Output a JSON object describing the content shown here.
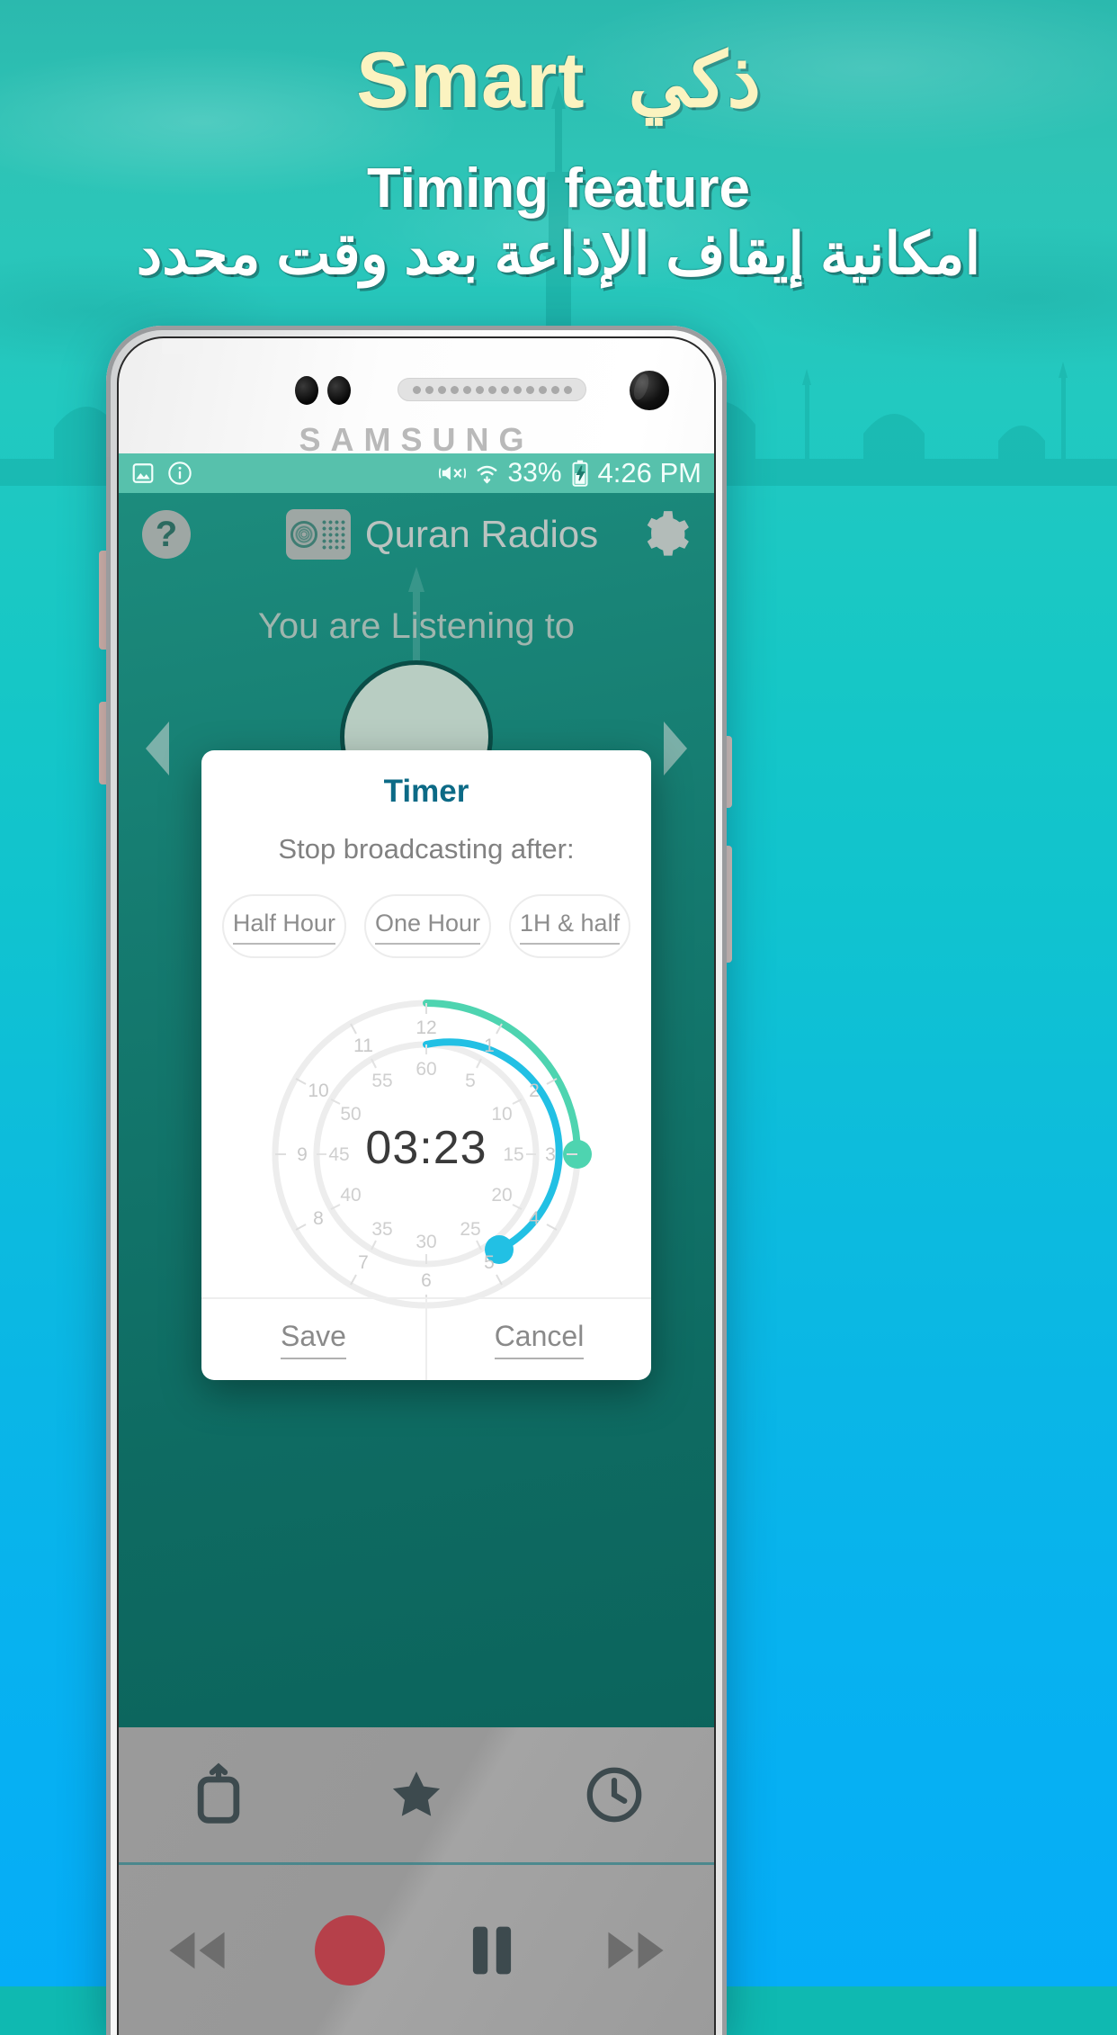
{
  "promo": {
    "headline_en": "Smart",
    "headline_ar": "ذكي",
    "subhead_en": "Timing feature",
    "subhead_ar": "امكانية إيقاف الإذاعة بعد وقت محدد"
  },
  "phone": {
    "brand": "SAMSUNG"
  },
  "statusbar": {
    "image_icon": "image-icon",
    "info_icon": "info-icon",
    "mute_icon": "volume-mute-icon",
    "wifi_icon": "wifi-icon",
    "battery_percent": "33%",
    "battery_icon": "battery-charging-icon",
    "clock": "4:26 PM"
  },
  "appbar": {
    "help_icon": "help-icon",
    "app_icon": "radio-icon",
    "title": "Quran Radios",
    "settings_icon": "gear-icon"
  },
  "screen": {
    "listening_label": "You are Listening to",
    "prev_chevron": "chevron-left-icon",
    "next_chevron": "chevron-right-icon"
  },
  "tabs": [
    {
      "name": "tab-radio",
      "icon": "radio-tower-icon"
    },
    {
      "name": "tab-favorites",
      "icon": "star-icon"
    },
    {
      "name": "tab-timer",
      "icon": "clock-icon"
    }
  ],
  "controls": [
    {
      "name": "rewind-button",
      "icon": "rewind-icon"
    },
    {
      "name": "record-button",
      "icon": "record-icon"
    },
    {
      "name": "pause-button",
      "icon": "pause-icon"
    },
    {
      "name": "forward-button",
      "icon": "fast-forward-icon"
    }
  ],
  "dialog": {
    "title": "Timer",
    "subtitle": "Stop broadcasting after:",
    "presets": [
      {
        "label": "Half Hour"
      },
      {
        "label": "One Hour"
      },
      {
        "label": "1H & half"
      }
    ],
    "time_value": "03:23",
    "save_label": "Save",
    "cancel_label": "Cancel"
  },
  "chart_data": {
    "type": "radial-dial",
    "title": "Timer dial",
    "value_text": "03:23",
    "rings": [
      {
        "name": "hours",
        "color": "#4ed4b0",
        "track_color": "#ececec",
        "ticks": [
          12,
          1,
          2,
          3,
          4,
          5,
          6,
          7,
          8,
          9,
          10,
          11
        ],
        "max": 12,
        "value": 3,
        "sweep_degrees": 90
      },
      {
        "name": "minutes",
        "color": "#22c0e4",
        "track_color": "#ececec",
        "ticks": [
          60,
          5,
          10,
          15,
          20,
          25,
          30,
          35,
          40,
          45,
          50,
          55
        ],
        "max": 60,
        "value": 23,
        "sweep_degrees": 138
      }
    ]
  },
  "colors": {
    "accent_green": "#4ed4b0",
    "accent_cyan": "#22c0e4",
    "dialog_title": "#0c6a86",
    "background_top": "#2bb9ae",
    "background_bottom": "#05adf7",
    "record_red": "#b6404a"
  }
}
